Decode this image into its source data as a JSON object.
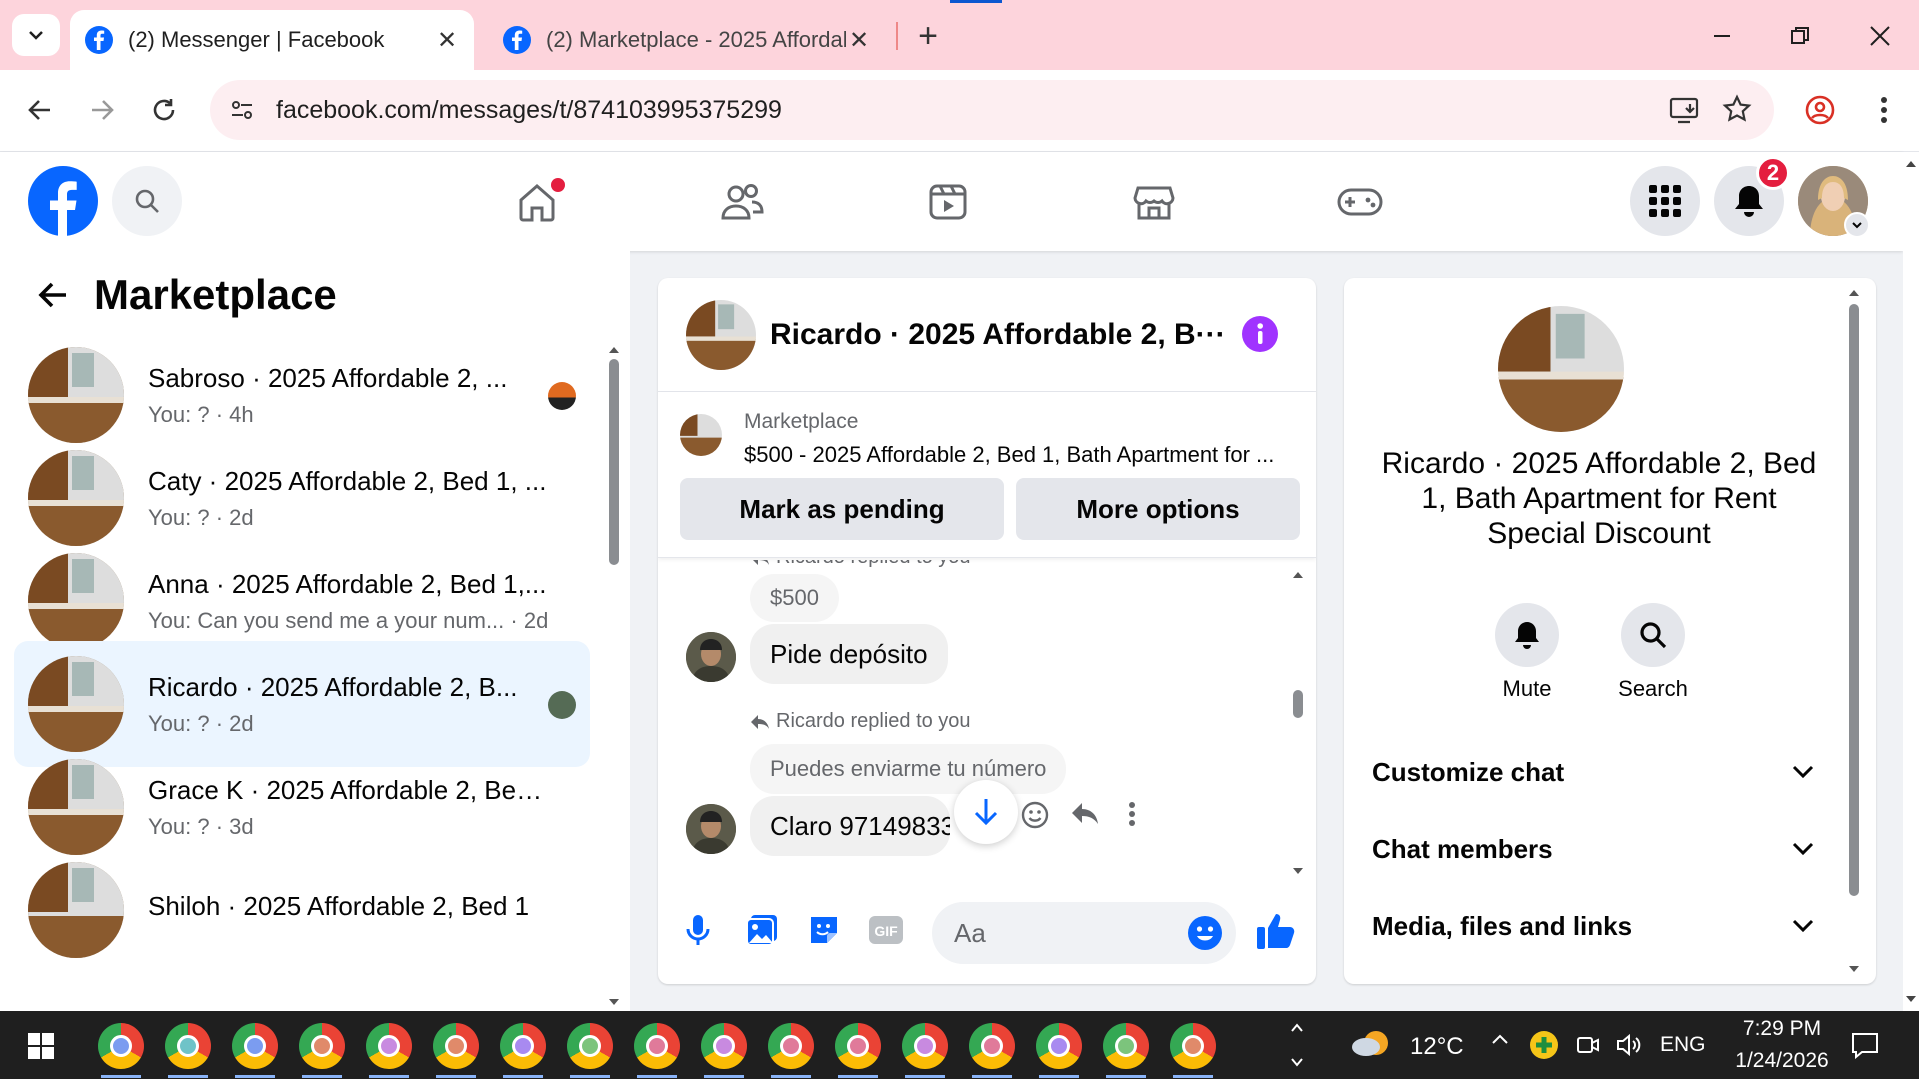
{
  "browser": {
    "tabs": [
      {
        "title": "(2) Messenger | Facebook",
        "active": true
      },
      {
        "title": "(2) Marketplace - 2025 Affordab",
        "active": false
      }
    ],
    "url": "facebook.com/messages/t/874103995375299"
  },
  "fb": {
    "notification_count": "2"
  },
  "left": {
    "title": "Marketplace",
    "conversations": [
      {
        "name": "Sabroso · 2025 Affordable 2, ...",
        "sub": "You: ? · 4h"
      },
      {
        "name": "Caty · 2025 Affordable 2, Bed 1, ...",
        "sub": "You: ? · 2d"
      },
      {
        "name": "Anna · 2025 Affordable 2, Bed 1,...",
        "sub": "You: Can you send me a your num...  · 2d"
      },
      {
        "name": "Ricardo · 2025 Affordable 2, B...",
        "sub": "You: ? · 2d"
      },
      {
        "name": "Grace K · 2025 Affordable 2, Bed...",
        "sub": "You: ? · 3d"
      },
      {
        "name": "Shiloh · 2025 Affordable 2, Bed 1",
        "sub": ""
      }
    ]
  },
  "chat": {
    "header_name": "Ricardo · 2025 Affordable 2, B···",
    "listing_label": "Marketplace",
    "listing_title": "$500 - 2025 Affordable 2, Bed 1, Bath Apartment for ...",
    "mark_pending": "Mark as pending",
    "more_options": "More options",
    "replied_partial": "Ricardo replied to you",
    "quote1": "$500",
    "msg1": "Pide depósito",
    "replied2": "Ricardo replied to you",
    "quote2": "Puedes enviarme tu número",
    "msg2": "Claro 97149833",
    "input_placeholder": "Aa"
  },
  "info": {
    "title": "Ricardo · 2025 Affordable 2, Bed 1, Bath Apartment for Rent Special Discount",
    "mute": "Mute",
    "search": "Search",
    "sections": [
      "Customize chat",
      "Chat members",
      "Media, files and links"
    ]
  },
  "taskbar": {
    "temp": "12°C",
    "lang": "ENG",
    "time": "7:29 PM",
    "date": "1/24/2026"
  },
  "colors": {
    "fb_blue": "#0866ff",
    "messenger_purple": "#a033ff",
    "tab_bg": "#fdd4dc"
  }
}
